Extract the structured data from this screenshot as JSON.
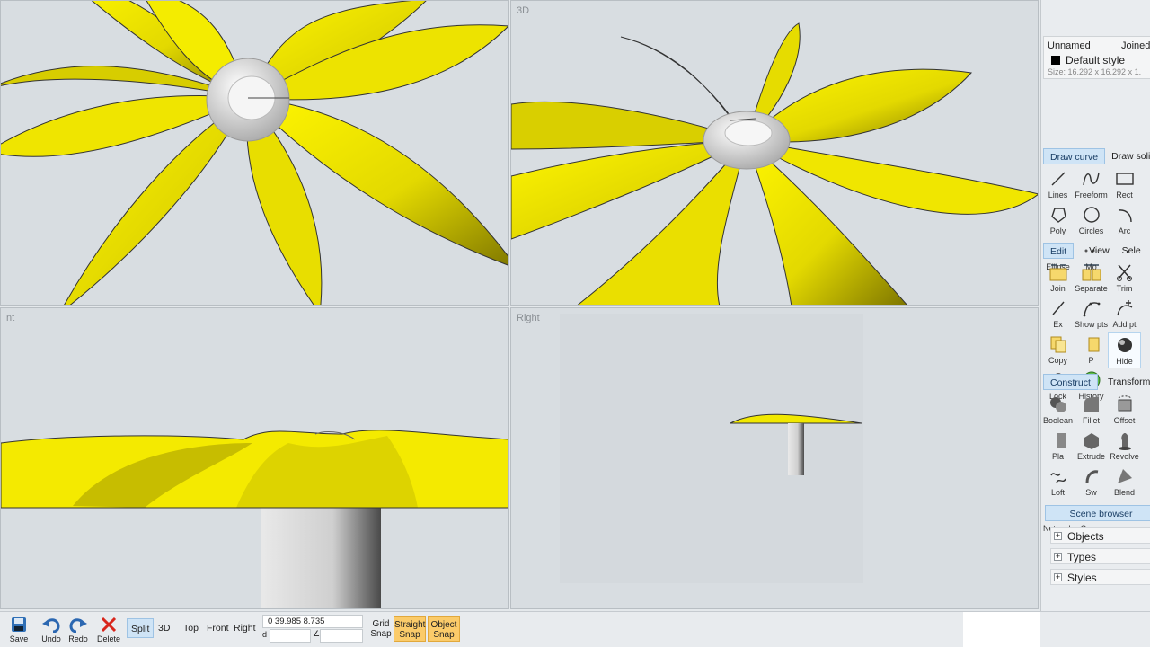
{
  "viewports": {
    "top": {
      "label": ""
    },
    "three_d": {
      "label": "3D"
    },
    "front": {
      "label": "nt"
    },
    "right": {
      "label": "Right"
    }
  },
  "properties": {
    "name": "Unnamed",
    "joined": "Joined",
    "style": "Default style",
    "size": "Size:  16.292 x 16.292 x 1."
  },
  "draw_tabs": [
    {
      "label": "Draw curve"
    },
    {
      "label": "Draw soli"
    }
  ],
  "draw_tools": [
    {
      "label": "Lines"
    },
    {
      "label": "Freeform"
    },
    {
      "label": "Rect"
    },
    {
      "label": "Poly"
    },
    {
      "label": "Circles"
    },
    {
      "label": "Arc"
    },
    {
      "label": "Ellipse"
    },
    {
      "label": "Mo"
    }
  ],
  "edit_tabs": [
    {
      "label": "Edit"
    },
    {
      "label": "View"
    },
    {
      "label": "Sele"
    }
  ],
  "edit_tools": [
    {
      "label": "Join"
    },
    {
      "label": "Separate"
    },
    {
      "label": "Trim"
    },
    {
      "label": "Ex"
    },
    {
      "label": "Show pts"
    },
    {
      "label": "Add pt"
    },
    {
      "label": "Copy"
    },
    {
      "label": "P"
    },
    {
      "label": "Hide"
    },
    {
      "label": "Lock"
    },
    {
      "label": "History"
    }
  ],
  "construct_tabs": [
    {
      "label": "Construct"
    },
    {
      "label": "Transform"
    }
  ],
  "construct_tools": [
    {
      "label": "Boolean"
    },
    {
      "label": "Fillet"
    },
    {
      "label": "Offset"
    },
    {
      "label": "Pla"
    },
    {
      "label": "Extrude"
    },
    {
      "label": "Revolve"
    },
    {
      "label": "Loft"
    },
    {
      "label": "Sw"
    },
    {
      "label": "Blend"
    },
    {
      "label": "Network"
    },
    {
      "label": "Curve"
    }
  ],
  "scene_browser": {
    "label": "Scene browser",
    "items": [
      {
        "label": "Objects"
      },
      {
        "label": "Types"
      },
      {
        "label": "Styles"
      }
    ]
  },
  "bottom": {
    "save": "Save",
    "undo": "Undo",
    "redo": "Redo",
    "delete": "Delete",
    "views": [
      {
        "label": "Split"
      },
      {
        "label": "3D"
      },
      {
        "label": "Top"
      },
      {
        "label": "Front"
      },
      {
        "label": "Right"
      }
    ],
    "coords": {
      "line1": "0          39.985  8.735",
      "d": "d",
      "angle": "∠"
    },
    "grid_snap": {
      "l1": "Grid",
      "l2": "Snap"
    },
    "straight_snap": {
      "l1": "Straight",
      "l2": "Snap"
    },
    "object_snap": {
      "l1": "Object",
      "l2": "Snap"
    }
  },
  "colors": {
    "petal": "#f2ea00",
    "petal_shade": "#8e8500",
    "accent": "#cfe4f6",
    "snap_active": "#fbcb6a"
  }
}
